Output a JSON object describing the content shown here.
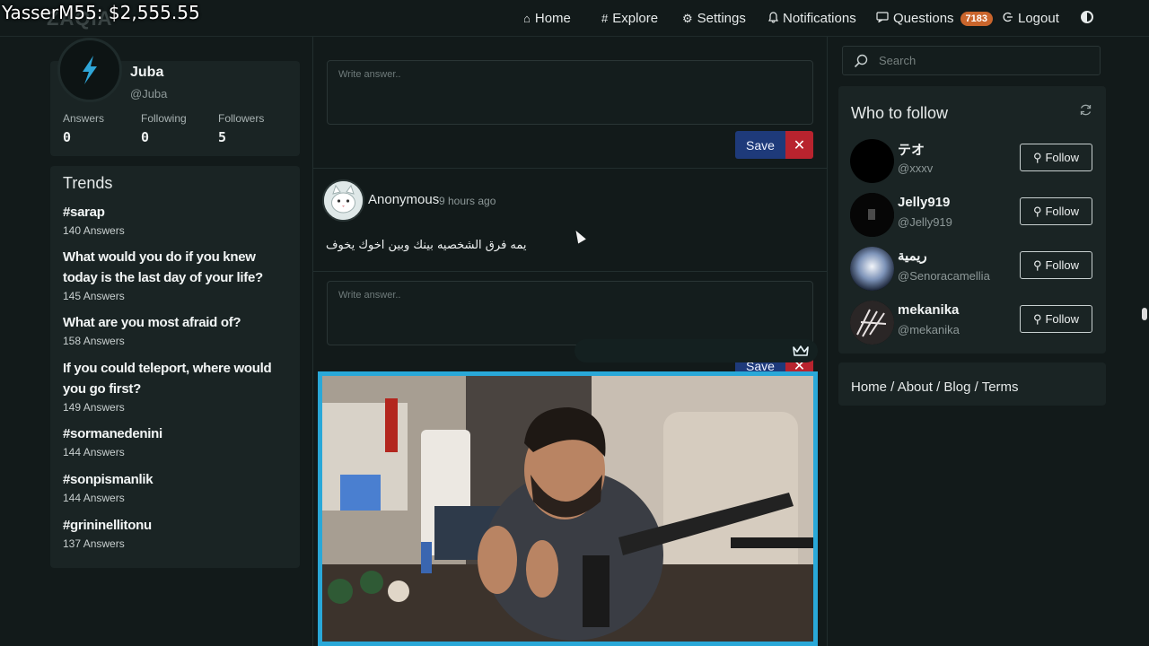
{
  "overlay": {
    "donation": "YasserM55: $2,555.55"
  },
  "logo": {
    "text": "ZAQIA"
  },
  "nav": {
    "home": "Home",
    "explore": "Explore",
    "settings": "Settings",
    "notifications": "Notifications",
    "questions": "Questions",
    "questions_count": "7183",
    "logout": "Logout"
  },
  "profile": {
    "name": "Juba",
    "handle": "@Juba",
    "stats": [
      {
        "label": "Answers",
        "value": "0"
      },
      {
        "label": "Following",
        "value": "0"
      },
      {
        "label": "Followers",
        "value": "5"
      }
    ]
  },
  "trends": {
    "title": "Trends",
    "items": [
      {
        "title": "#sarap",
        "count": "140 Answers"
      },
      {
        "title": "What would you do if you knew today is the last day of your life?",
        "count": "145 Answers"
      },
      {
        "title": "What are you most afraid of?",
        "count": "158 Answers"
      },
      {
        "title": "If you could teleport, where would you go first?",
        "count": "149 Answers"
      },
      {
        "title": "#sormanedenini",
        "count": "144 Answers"
      },
      {
        "title": "#sonpismanlik",
        "count": "144 Answers"
      },
      {
        "title": "#grininellitonu",
        "count": "137 Answers"
      }
    ]
  },
  "feed": {
    "answer_placeholder": "Write answer..",
    "save_label": "Save",
    "cancel_label": "✕",
    "question": {
      "author": "Anonymous",
      "time": "9 hours ago",
      "text": "يمه فرق الشخصيه بينك وبين اخوك يخوف"
    }
  },
  "search": {
    "placeholder": "Search"
  },
  "who_to_follow": {
    "title": "Who to follow",
    "follow_label": "Follow",
    "users": [
      {
        "name": "テオ",
        "handle": "@xxxv"
      },
      {
        "name": "Jelly919",
        "handle": "@Jelly919"
      },
      {
        "name": "ريمية",
        "handle": "@Senoracamellia"
      },
      {
        "name": "mekanika",
        "handle": "@mekanika"
      }
    ]
  },
  "footer": {
    "links": [
      "Home",
      "About",
      "Blog",
      "Terms"
    ],
    "separator": " / "
  },
  "icons": {
    "home": "house-icon",
    "explore": "hash-icon",
    "settings": "gear-icon",
    "notifications": "bell-icon",
    "questions": "chat-icon",
    "logout": "logout-icon",
    "theme": "contrast-icon",
    "search": "search-icon",
    "refresh": "refresh-icon",
    "follow": "user-plus-icon",
    "crown": "crown-icon"
  },
  "colors": {
    "background": "#121a1a",
    "card": "#1a2424",
    "save": "#1e3a7a",
    "cancel": "#b8232e",
    "badge": "#c9652c",
    "cam_border": "#29a8d8"
  }
}
